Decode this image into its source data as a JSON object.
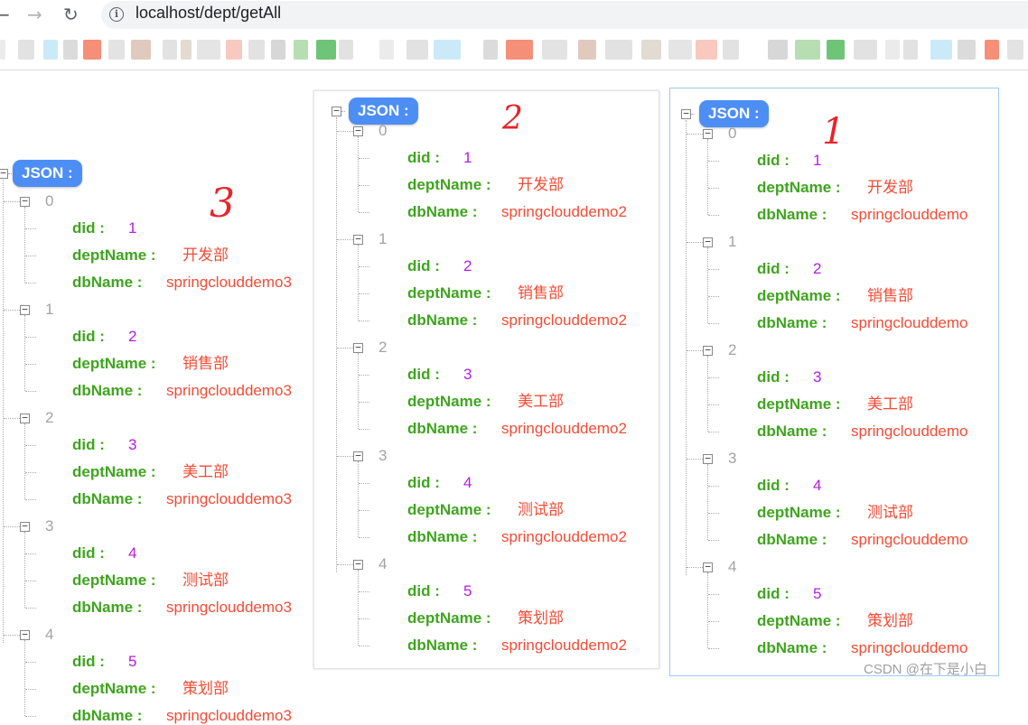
{
  "browser": {
    "url": "localhost/dept/getAll",
    "bookmark_colors": [
      "#e4e4e4",
      "#d8d8d8",
      "#b9e3f5",
      "#cfcfcf",
      "#f26a4a",
      "#d9d9d9",
      "#d6b8a8",
      "#d8d8d8",
      "#d8cfc2",
      "#dcdcdc",
      "#f4b7a9",
      "#d8d8d8",
      "#c9c9c9",
      "#9fd39a",
      "#3fb24a",
      "#d8d8d8"
    ]
  },
  "colors": {
    "badge": "#4d8ef5",
    "index": "#a3a3a3",
    "key": "#3fa51f",
    "number": "#b31ce4",
    "string": "#f44b35",
    "annotation": "#e8252b"
  },
  "badge_label": "JSON :",
  "key_labels": {
    "did": "did :",
    "deptName": "deptName :",
    "dbName": "dbName :"
  },
  "panels": [
    {
      "annotation": "3",
      "rows": [
        {
          "index": "0",
          "did": "1",
          "deptName": "开发部",
          "dbName": "springclouddemo3"
        },
        {
          "index": "1",
          "did": "2",
          "deptName": "销售部",
          "dbName": "springclouddemo3"
        },
        {
          "index": "2",
          "did": "3",
          "deptName": "美工部",
          "dbName": "springclouddemo3"
        },
        {
          "index": "3",
          "did": "4",
          "deptName": "测试部",
          "dbName": "springclouddemo3"
        },
        {
          "index": "4",
          "did": "5",
          "deptName": "策划部",
          "dbName": "springclouddemo3"
        }
      ]
    },
    {
      "annotation": "2",
      "rows": [
        {
          "index": "0",
          "did": "1",
          "deptName": "开发部",
          "dbName": "springclouddemo2"
        },
        {
          "index": "1",
          "did": "2",
          "deptName": "销售部",
          "dbName": "springclouddemo2"
        },
        {
          "index": "2",
          "did": "3",
          "deptName": "美工部",
          "dbName": "springclouddemo2"
        },
        {
          "index": "3",
          "did": "4",
          "deptName": "测试部",
          "dbName": "springclouddemo2"
        },
        {
          "index": "4",
          "did": "5",
          "deptName": "策划部",
          "dbName": "springclouddemo2"
        }
      ]
    },
    {
      "annotation": "1",
      "rows": [
        {
          "index": "0",
          "did": "1",
          "deptName": "开发部",
          "dbName": "springclouddemo"
        },
        {
          "index": "1",
          "did": "2",
          "deptName": "销售部",
          "dbName": "springclouddemo"
        },
        {
          "index": "2",
          "did": "3",
          "deptName": "美工部",
          "dbName": "springclouddemo"
        },
        {
          "index": "3",
          "did": "4",
          "deptName": "测试部",
          "dbName": "springclouddemo"
        },
        {
          "index": "4",
          "did": "5",
          "deptName": "策划部",
          "dbName": "springclouddemo"
        }
      ]
    }
  ],
  "watermark": "CSDN @在下是小白"
}
